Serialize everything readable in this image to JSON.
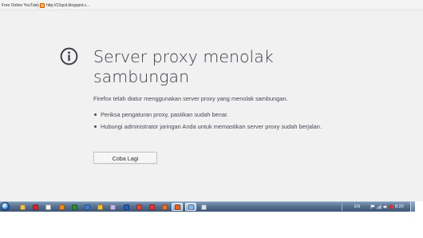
{
  "bookmarks": [
    {
      "label": "Free Online YouTube...",
      "icon": "page-icon"
    },
    {
      "label": "http://13qcd.blogspot.c...",
      "icon": "blogger-icon"
    }
  ],
  "error_page": {
    "icon": "info-icon",
    "title": "Server proxy menolak sambungan",
    "description": "Firefox telah diatur menggunakan server proxy yang menolak sambungan.",
    "suggestions": [
      "Periksa pengaturan proxy, pastikan sudah benar.",
      "Hubungi administrator jaringan Anda untuk memastikan server proxy sudah berjalan."
    ],
    "retry_label": "Coba Lagi"
  },
  "taskbar": {
    "pinned_icons": [
      {
        "name": "explorer-icon",
        "color": "#e8c45a"
      },
      {
        "name": "acrobat-icon",
        "color": "#d9262a"
      },
      {
        "name": "document-icon",
        "color": "#f2f2f2"
      },
      {
        "name": "media-icon",
        "color": "#f08c1e"
      },
      {
        "name": "excel-icon",
        "color": "#2e8b3a"
      },
      {
        "name": "app-icon",
        "color": "#3f7fd6"
      },
      {
        "name": "folder-icon",
        "color": "#f0c23c"
      },
      {
        "name": "paint-icon",
        "color": "#cbb8e8"
      },
      {
        "name": "word-icon",
        "color": "#2a5db8"
      },
      {
        "name": "chrome-icon",
        "color": "#e04b3a"
      },
      {
        "name": "flashget-icon",
        "color": "#e53935"
      },
      {
        "name": "powerpoint-icon",
        "color": "#e5742a"
      },
      {
        "name": "firefox-icon",
        "color": "#e0652a"
      },
      {
        "name": "explorer-window-icon",
        "color": "#8fb7e8"
      },
      {
        "name": "notepad-icon",
        "color": "#d8e4f2"
      }
    ],
    "tray": {
      "language": "EN",
      "clock": "8:20"
    }
  },
  "colors": {
    "page_background": "#f1f1f2",
    "title_text": "#3b3b47",
    "body_text": "#484855",
    "taskbar": "#56708f"
  }
}
